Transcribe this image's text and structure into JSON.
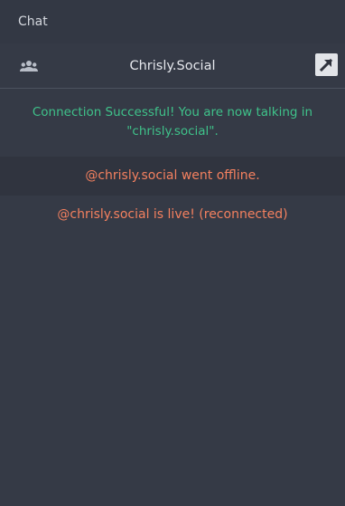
{
  "header": {
    "title": "Chat"
  },
  "room": {
    "title": "Chrisly.Social",
    "users_icon": "users-icon",
    "popout_icon": "arrow-up-right-icon"
  },
  "messages": [
    {
      "type": "success",
      "text": "Connection Successful! You are now talking in \"chrisly.social\"."
    },
    {
      "type": "status",
      "text": "@chrisly.social went offline."
    },
    {
      "type": "status",
      "text": "@chrisly.social is live! (reconnected)"
    }
  ],
  "colors": {
    "background": "#353a46",
    "success": "#3fc28a",
    "status": "#f3805f"
  }
}
